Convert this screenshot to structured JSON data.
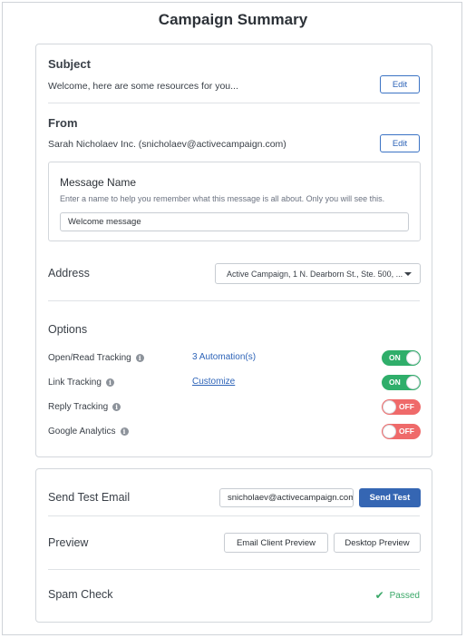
{
  "page": {
    "title": "Campaign Summary"
  },
  "subject": {
    "heading": "Subject",
    "value": "Welcome, here are some resources for you...",
    "edit_label": "Edit"
  },
  "from": {
    "heading": "From",
    "value": "Sarah Nicholaev Inc. (snicholaev@activecampaign.com)",
    "edit_label": "Edit"
  },
  "message_name": {
    "heading": "Message Name",
    "hint": "Enter a name to help you remember what this message is all about. Only you will see this.",
    "value": "Welcome message"
  },
  "address": {
    "heading": "Address",
    "selected": "Active Campaign, 1 N. Dearborn St., Ste. 500, ..."
  },
  "options": {
    "heading": "Options",
    "items": [
      {
        "label": "Open/Read Tracking",
        "link": "3 Automation(s)",
        "state": "ON"
      },
      {
        "label": "Link Tracking",
        "link": "Customize",
        "state": "ON"
      },
      {
        "label": "Reply Tracking",
        "link": "",
        "state": "OFF"
      },
      {
        "label": "Google Analytics",
        "link": "",
        "state": "OFF"
      }
    ]
  },
  "send_test": {
    "heading": "Send Test Email",
    "email_value": "snicholaev@activecampaign.com",
    "button_label": "Send Test"
  },
  "preview": {
    "heading": "Preview",
    "email_client_label": "Email Client Preview",
    "desktop_label": "Desktop Preview"
  },
  "spam_check": {
    "heading": "Spam Check",
    "status": "Passed"
  },
  "colors": {
    "toggle_on": "#2fae6a",
    "toggle_off": "#ef6a6a",
    "primary": "#3566b3",
    "link": "#2e64b8",
    "passed": "#3aa868"
  }
}
